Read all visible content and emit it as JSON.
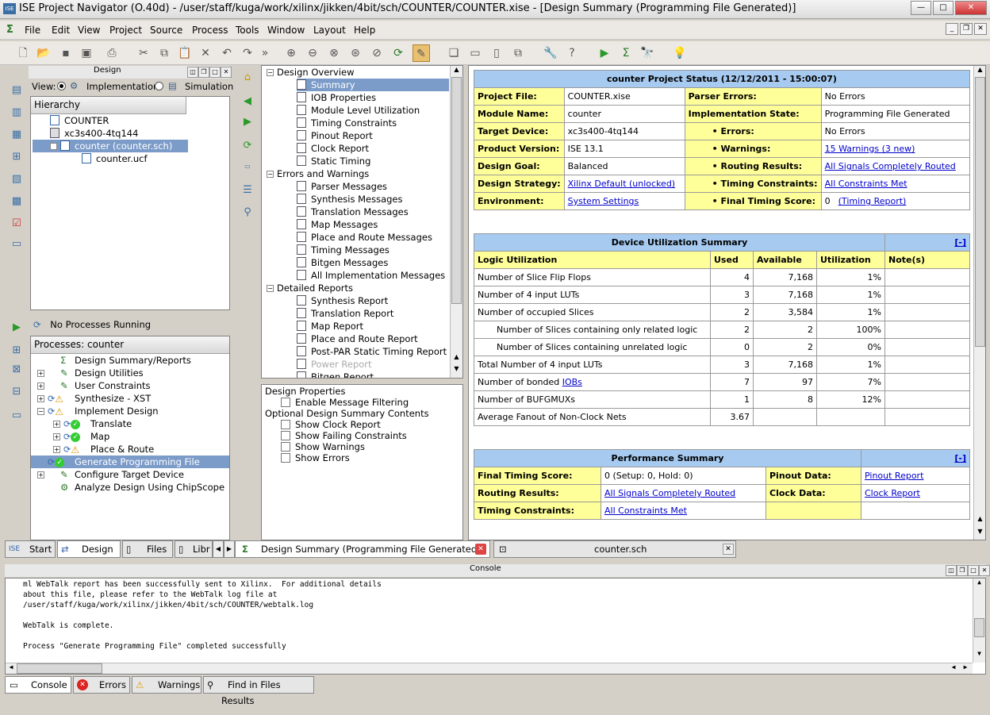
{
  "window": {
    "title": "ISE Project Navigator (O.40d) - /user/staff/kuga/work/xilinx/jikken/4bit/sch/COUNTER/COUNTER.xise - [Design Summary (Programming File Generated)]",
    "app_icon": "ISE"
  },
  "menu": [
    "File",
    "Edit",
    "View",
    "Project",
    "Source",
    "Process",
    "Tools",
    "Window",
    "Layout",
    "Help"
  ],
  "design_panel": {
    "title": "Design",
    "view_label": "View:",
    "view_impl": "Implementation",
    "view_sim": "Simulation",
    "hierarchy_label": "Hierarchy",
    "hierarchy": [
      {
        "label": "COUNTER",
        "level": 0
      },
      {
        "label": "xc3s400-4tq144",
        "level": 0
      },
      {
        "label": "counter (counter.sch)",
        "level": 1,
        "selected": true
      },
      {
        "label": "counter.ucf",
        "level": 2
      }
    ],
    "no_processes": "No Processes Running",
    "processes_label": "Processes: counter",
    "processes": [
      {
        "label": "Design Summary/Reports",
        "level": 0,
        "status": "",
        "expand": false
      },
      {
        "label": "Design Utilities",
        "level": 0,
        "status": "",
        "expand": true
      },
      {
        "label": "User Constraints",
        "level": 0,
        "status": "",
        "expand": true
      },
      {
        "label": "Synthesize - XST",
        "level": 0,
        "status": "warn",
        "expand": true
      },
      {
        "label": "Implement Design",
        "level": 0,
        "status": "warn",
        "expand": "minus"
      },
      {
        "label": "Translate",
        "level": 1,
        "status": "ok",
        "expand": true
      },
      {
        "label": "Map",
        "level": 1,
        "status": "ok",
        "expand": true
      },
      {
        "label": "Place & Route",
        "level": 1,
        "status": "warn",
        "expand": true
      },
      {
        "label": "Generate Programming File",
        "level": 0,
        "status": "ok",
        "expand": false,
        "selected": true
      },
      {
        "label": "Configure Target Device",
        "level": 0,
        "status": "",
        "expand": true
      },
      {
        "label": "Analyze Design Using ChipScope",
        "level": 0,
        "status": "",
        "expand": false
      }
    ]
  },
  "left_tabs": [
    "Start",
    "Design",
    "Files",
    "Libr"
  ],
  "nav_tree": [
    {
      "label": "Design Overview",
      "level": 0,
      "folder": true
    },
    {
      "label": "Summary",
      "level": 1,
      "selected": true
    },
    {
      "label": "IOB Properties",
      "level": 1
    },
    {
      "label": "Module Level Utilization",
      "level": 1
    },
    {
      "label": "Timing Constraints",
      "level": 1
    },
    {
      "label": "Pinout Report",
      "level": 1
    },
    {
      "label": "Clock Report",
      "level": 1
    },
    {
      "label": "Static Timing",
      "level": 1
    },
    {
      "label": "Errors and Warnings",
      "level": 0,
      "folder": true
    },
    {
      "label": "Parser Messages",
      "level": 1
    },
    {
      "label": "Synthesis Messages",
      "level": 1
    },
    {
      "label": "Translation Messages",
      "level": 1
    },
    {
      "label": "Map Messages",
      "level": 1
    },
    {
      "label": "Place and Route Messages",
      "level": 1
    },
    {
      "label": "Timing Messages",
      "level": 1
    },
    {
      "label": "Bitgen Messages",
      "level": 1
    },
    {
      "label": "All Implementation Messages",
      "level": 1
    },
    {
      "label": "Detailed Reports",
      "level": 0,
      "folder": true
    },
    {
      "label": "Synthesis Report",
      "level": 1
    },
    {
      "label": "Translation Report",
      "level": 1
    },
    {
      "label": "Map Report",
      "level": 1
    },
    {
      "label": "Place and Route Report",
      "level": 1
    },
    {
      "label": "Post-PAR Static Timing Report",
      "level": 1
    },
    {
      "label": "Power Report",
      "level": 1,
      "disabled": true
    },
    {
      "label": "Bitgen Report",
      "level": 1
    }
  ],
  "props": {
    "title": "Design Properties",
    "enable_filter": "Enable Message Filtering",
    "optional_title": "Optional Design Summary Contents",
    "options": [
      "Show Clock Report",
      "Show Failing Constraints",
      "Show Warnings",
      "Show Errors"
    ]
  },
  "status": {
    "title": "counter Project Status (12/12/2011 - 15:00:07)",
    "rows": [
      [
        "Project File:",
        "COUNTER.xise",
        "Parser Errors:",
        "No Errors"
      ],
      [
        "Module Name:",
        "counter",
        "Implementation State:",
        "Programming File Generated"
      ],
      [
        "Target Device:",
        "xc3s400-4tq144",
        "• Errors:",
        "No Errors"
      ],
      [
        "Product Version:",
        "ISE 13.1",
        "• Warnings:",
        "15 Warnings (3 new)"
      ],
      [
        "Design Goal:",
        "Balanced",
        "• Routing Results:",
        "All Signals Completely Routed"
      ],
      [
        "Design Strategy:",
        "Xilinx Default (unlocked)",
        "• Timing Constraints:",
        "All Constraints Met"
      ],
      [
        "Environment:",
        "System Settings",
        "• Final Timing Score:",
        "0"
      ]
    ],
    "timing_report_link": "(Timing Report)"
  },
  "util": {
    "title": "Device Utilization Summary",
    "collapse": "[-]",
    "headers": [
      "Logic Utilization",
      "Used",
      "Available",
      "Utilization",
      "Note(s)"
    ],
    "rows": [
      [
        "Number of Slice Flip Flops",
        "4",
        "7,168",
        "1%",
        ""
      ],
      [
        "Number of 4 input LUTs",
        "3",
        "7,168",
        "1%",
        ""
      ],
      [
        "Number of occupied Slices",
        "2",
        "3,584",
        "1%",
        ""
      ],
      [
        "Number of Slices containing only related logic",
        "2",
        "2",
        "100%",
        ""
      ],
      [
        "Number of Slices containing unrelated logic",
        "0",
        "2",
        "0%",
        ""
      ],
      [
        "Total Number of 4 input LUTs",
        "3",
        "7,168",
        "1%",
        ""
      ],
      [
        "Number of bonded IOBs",
        "7",
        "97",
        "7%",
        ""
      ],
      [
        "Number of BUFGMUXs",
        "1",
        "8",
        "12%",
        ""
      ],
      [
        "Average Fanout of Non-Clock Nets",
        "3.67",
        "",
        "",
        ""
      ]
    ]
  },
  "perf": {
    "title": "Performance Summary",
    "collapse": "[-]",
    "rows": [
      [
        "Final Timing Score:",
        "0 (Setup: 0, Hold: 0)",
        "Pinout Data:",
        "Pinout Report"
      ],
      [
        "Routing Results:",
        "All Signals Completely Routed",
        "Clock Data:",
        "Clock Report"
      ],
      [
        "Timing Constraints:",
        "All Constraints Met",
        "",
        ""
      ]
    ]
  },
  "doc_tabs": [
    "Design Summary (Programming File Generated)",
    "counter.sch"
  ],
  "console": {
    "title": "Console",
    "lines": [
      "ml WebTalk report has been successfully sent to Xilinx.  For additional details",
      "about this file, please refer to the WebTalk log file at",
      "/user/staff/kuga/work/xilinx/jikken/4bit/sch/COUNTER/webtalk.log",
      "",
      "WebTalk is complete.",
      "",
      "Process \"Generate Programming File\" completed successfully"
    ]
  },
  "bottom_tabs": [
    "Console",
    "Errors",
    "Warnings",
    "Find in Files Results"
  ]
}
